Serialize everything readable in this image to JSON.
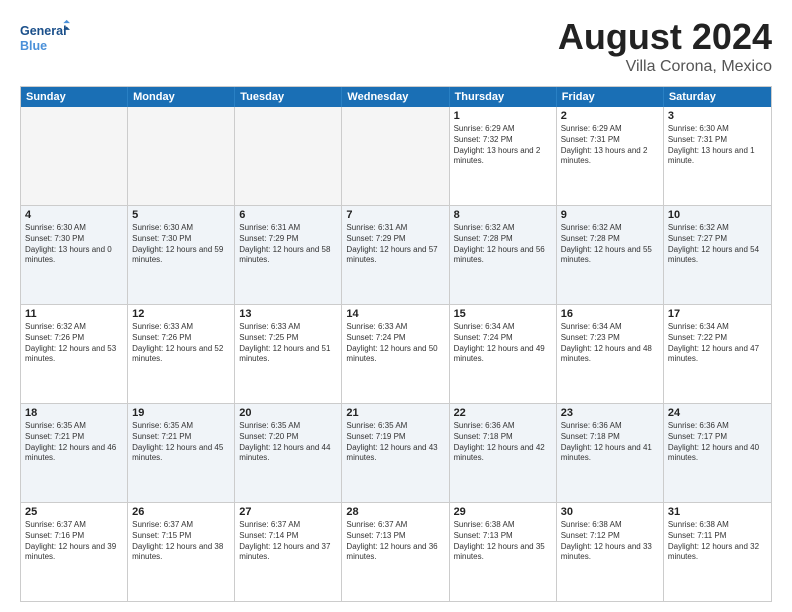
{
  "logo": {
    "line1": "General",
    "line2": "Blue"
  },
  "title": "August 2024",
  "subtitle": "Villa Corona, Mexico",
  "header_days": [
    "Sunday",
    "Monday",
    "Tuesday",
    "Wednesday",
    "Thursday",
    "Friday",
    "Saturday"
  ],
  "rows": [
    [
      {
        "day": "",
        "empty": true
      },
      {
        "day": "",
        "empty": true
      },
      {
        "day": "",
        "empty": true
      },
      {
        "day": "",
        "empty": true
      },
      {
        "day": "1",
        "rise": "6:29 AM",
        "set": "7:32 PM",
        "daylight": "13 hours and 2 minutes."
      },
      {
        "day": "2",
        "rise": "6:29 AM",
        "set": "7:31 PM",
        "daylight": "13 hours and 2 minutes."
      },
      {
        "day": "3",
        "rise": "6:30 AM",
        "set": "7:31 PM",
        "daylight": "13 hours and 1 minute."
      }
    ],
    [
      {
        "day": "4",
        "rise": "6:30 AM",
        "set": "7:30 PM",
        "daylight": "13 hours and 0 minutes."
      },
      {
        "day": "5",
        "rise": "6:30 AM",
        "set": "7:30 PM",
        "daylight": "12 hours and 59 minutes."
      },
      {
        "day": "6",
        "rise": "6:31 AM",
        "set": "7:29 PM",
        "daylight": "12 hours and 58 minutes."
      },
      {
        "day": "7",
        "rise": "6:31 AM",
        "set": "7:29 PM",
        "daylight": "12 hours and 57 minutes."
      },
      {
        "day": "8",
        "rise": "6:32 AM",
        "set": "7:28 PM",
        "daylight": "12 hours and 56 minutes."
      },
      {
        "day": "9",
        "rise": "6:32 AM",
        "set": "7:28 PM",
        "daylight": "12 hours and 55 minutes."
      },
      {
        "day": "10",
        "rise": "6:32 AM",
        "set": "7:27 PM",
        "daylight": "12 hours and 54 minutes."
      }
    ],
    [
      {
        "day": "11",
        "rise": "6:32 AM",
        "set": "7:26 PM",
        "daylight": "12 hours and 53 minutes."
      },
      {
        "day": "12",
        "rise": "6:33 AM",
        "set": "7:26 PM",
        "daylight": "12 hours and 52 minutes."
      },
      {
        "day": "13",
        "rise": "6:33 AM",
        "set": "7:25 PM",
        "daylight": "12 hours and 51 minutes."
      },
      {
        "day": "14",
        "rise": "6:33 AM",
        "set": "7:24 PM",
        "daylight": "12 hours and 50 minutes."
      },
      {
        "day": "15",
        "rise": "6:34 AM",
        "set": "7:24 PM",
        "daylight": "12 hours and 49 minutes."
      },
      {
        "day": "16",
        "rise": "6:34 AM",
        "set": "7:23 PM",
        "daylight": "12 hours and 48 minutes."
      },
      {
        "day": "17",
        "rise": "6:34 AM",
        "set": "7:22 PM",
        "daylight": "12 hours and 47 minutes."
      }
    ],
    [
      {
        "day": "18",
        "rise": "6:35 AM",
        "set": "7:21 PM",
        "daylight": "12 hours and 46 minutes."
      },
      {
        "day": "19",
        "rise": "6:35 AM",
        "set": "7:21 PM",
        "daylight": "12 hours and 45 minutes."
      },
      {
        "day": "20",
        "rise": "6:35 AM",
        "set": "7:20 PM",
        "daylight": "12 hours and 44 minutes."
      },
      {
        "day": "21",
        "rise": "6:35 AM",
        "set": "7:19 PM",
        "daylight": "12 hours and 43 minutes."
      },
      {
        "day": "22",
        "rise": "6:36 AM",
        "set": "7:18 PM",
        "daylight": "12 hours and 42 minutes."
      },
      {
        "day": "23",
        "rise": "6:36 AM",
        "set": "7:18 PM",
        "daylight": "12 hours and 41 minutes."
      },
      {
        "day": "24",
        "rise": "6:36 AM",
        "set": "7:17 PM",
        "daylight": "12 hours and 40 minutes."
      }
    ],
    [
      {
        "day": "25",
        "rise": "6:37 AM",
        "set": "7:16 PM",
        "daylight": "12 hours and 39 minutes."
      },
      {
        "day": "26",
        "rise": "6:37 AM",
        "set": "7:15 PM",
        "daylight": "12 hours and 38 minutes."
      },
      {
        "day": "27",
        "rise": "6:37 AM",
        "set": "7:14 PM",
        "daylight": "12 hours and 37 minutes."
      },
      {
        "day": "28",
        "rise": "6:37 AM",
        "set": "7:13 PM",
        "daylight": "12 hours and 36 minutes."
      },
      {
        "day": "29",
        "rise": "6:38 AM",
        "set": "7:13 PM",
        "daylight": "12 hours and 35 minutes."
      },
      {
        "day": "30",
        "rise": "6:38 AM",
        "set": "7:12 PM",
        "daylight": "12 hours and 33 minutes."
      },
      {
        "day": "31",
        "rise": "6:38 AM",
        "set": "7:11 PM",
        "daylight": "12 hours and 32 minutes."
      }
    ]
  ]
}
